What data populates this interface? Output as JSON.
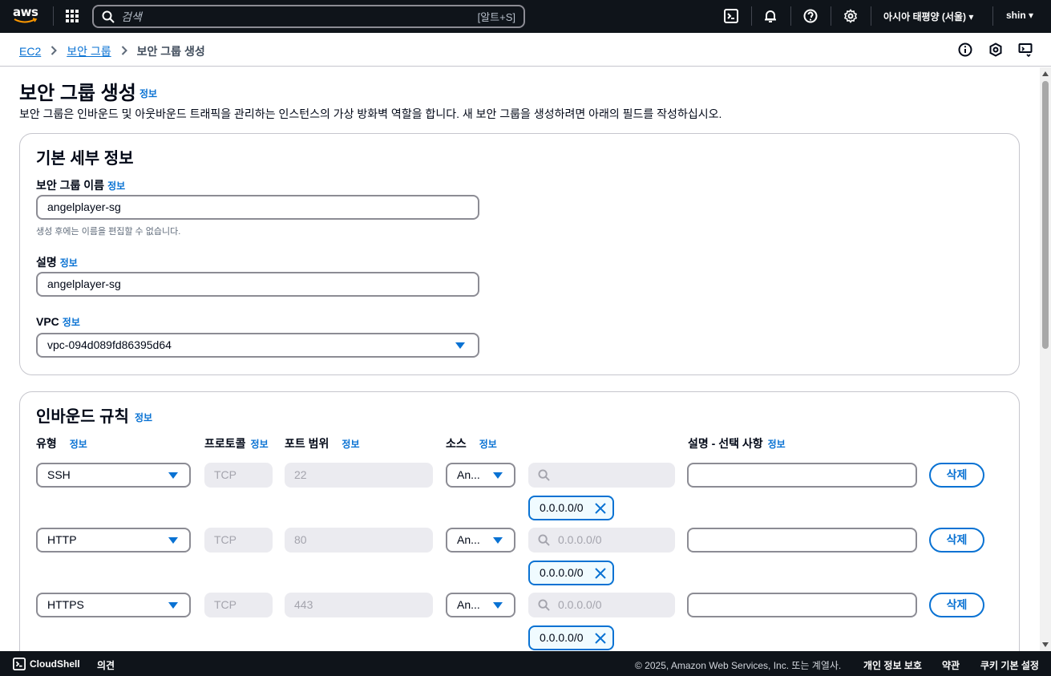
{
  "topnav": {
    "logo_text": "aws",
    "search_placeholder": "검색",
    "search_shortcut": "[알트+S]",
    "region": "아시아 태평양 (서울) ▾",
    "user": "shin ▾"
  },
  "breadcrumb": {
    "items": [
      "EC2",
      "보안 그룹"
    ],
    "current": "보안 그룹 생성"
  },
  "page": {
    "title": "보안 그룹 생성",
    "info": "정보",
    "description": "보안 그룹은 인바운드 및 아웃바운드 트래픽을 관리하는 인스턴스의 가상 방화벽 역할을 합니다. 새 보안 그룹을 생성하려면 아래의 필드를 작성하십시오."
  },
  "basic": {
    "title": "기본 세부 정보",
    "name_label": "보안 그룹 이름",
    "name_value": "angelplayer-sg",
    "name_hint": "생성 후에는 이름을 편집할 수 없습니다.",
    "desc_label": "설명",
    "desc_value": "angelplayer-sg",
    "vpc_label": "VPC",
    "vpc_value": "vpc-094d089fd86395d64",
    "info": "정보"
  },
  "inbound": {
    "title": "인바운드 규칙",
    "info": "정보",
    "columns": {
      "type": "유형",
      "protocol": "프로토콜",
      "port": "포트 범위",
      "source": "소스",
      "description": "설명 - 선택 사항"
    },
    "rows": [
      {
        "type": "SSH",
        "protocol": "TCP",
        "port": "22",
        "source": "An...",
        "search": "",
        "token": "0.0.0.0/0",
        "delete": "삭제"
      },
      {
        "type": "HTTP",
        "protocol": "TCP",
        "port": "80",
        "source": "An...",
        "search": "0.0.0.0/0",
        "token": "0.0.0.0/0",
        "delete": "삭제"
      },
      {
        "type": "HTTPS",
        "protocol": "TCP",
        "port": "443",
        "source": "An...",
        "search": "0.0.0.0/0",
        "token": "0.0.0.0/0",
        "delete": "삭제"
      }
    ]
  },
  "footer": {
    "cloudshell": "CloudShell",
    "feedback": "의견",
    "copyright": "© 2025, Amazon Web Services, Inc. 또는 계열사.",
    "privacy": "개인 정보 보호",
    "terms": "약관",
    "cookies": "쿠키 기본 설정"
  }
}
